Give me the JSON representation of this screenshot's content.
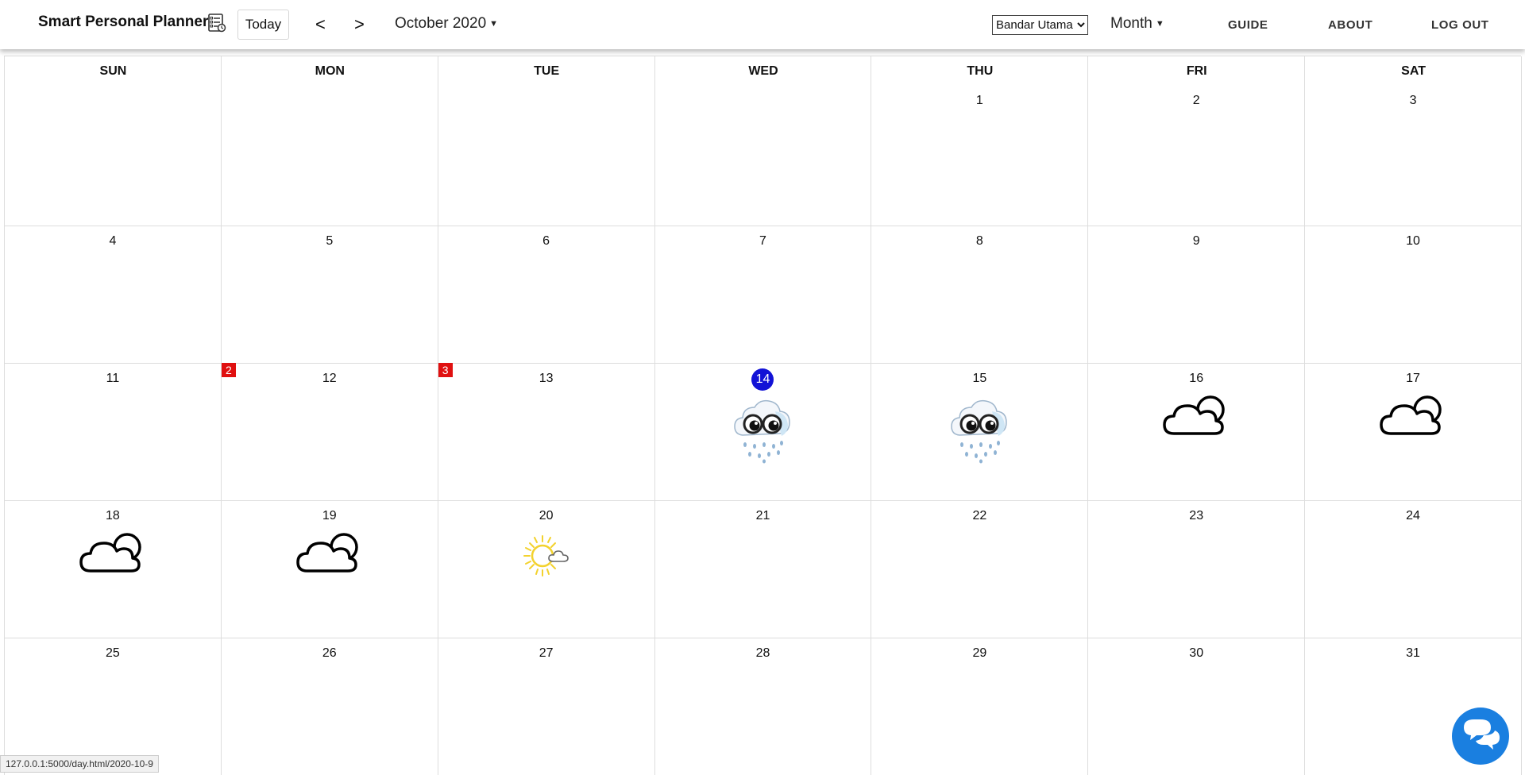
{
  "app": {
    "title": "Smart Personal Planner",
    "today_label": "Today",
    "prev_label": "<",
    "next_label": ">",
    "month_label": "October 2020",
    "location": "Bandar Utama",
    "location_options": [
      "Bandar Utama"
    ],
    "view_label": "Month",
    "nav": {
      "guide": "GUIDE",
      "about": "ABOUT",
      "logout": "LOG OUT"
    }
  },
  "calendar": {
    "weekdays": [
      "SUN",
      "MON",
      "TUE",
      "WED",
      "THU",
      "FRI",
      "SAT"
    ],
    "weeks": [
      [
        null,
        null,
        null,
        null,
        "1",
        "2",
        "3"
      ],
      [
        "4",
        "5",
        "6",
        "7",
        "8",
        "9",
        "10"
      ],
      [
        "11",
        "12",
        "13",
        "14",
        "15",
        "16",
        "17"
      ],
      [
        "18",
        "19",
        "20",
        "21",
        "22",
        "23",
        "24"
      ],
      [
        "25",
        "26",
        "27",
        "28",
        "29",
        "30",
        "31"
      ]
    ],
    "today": "14",
    "badges": {
      "12": "2",
      "13": "3"
    },
    "weather": {
      "14": "rain-cloud-icon",
      "15": "rain-cloud-icon",
      "16": "partly-cloudy-icon",
      "17": "partly-cloudy-icon",
      "18": "partly-cloudy-icon",
      "19": "partly-cloudy-icon",
      "20": "sunny-cloud-icon"
    },
    "colors": {
      "today": "#1212d6",
      "badge": "#e01010",
      "grid": "#dddddd"
    }
  },
  "status_bar": {
    "url": "127.0.0.1:5000/day.html/2020-10-9"
  },
  "chat": {
    "icon": "chat-bubbles-icon",
    "color": "#1a7fe0"
  }
}
